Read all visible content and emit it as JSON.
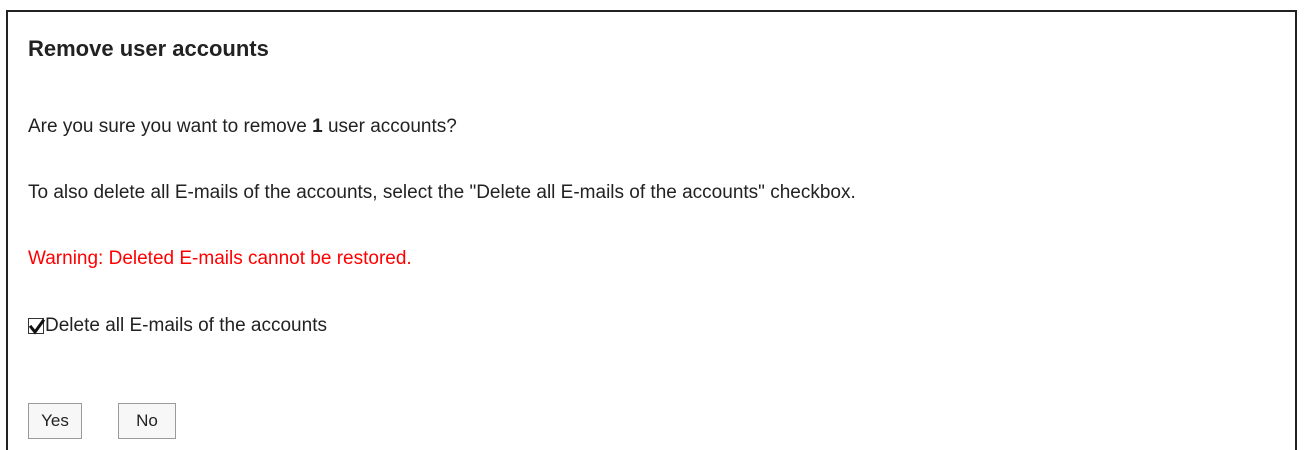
{
  "dialog": {
    "title": "Remove user accounts",
    "confirm_prefix": "Are you sure you want to remove ",
    "count": "1",
    "confirm_suffix": " user accounts?",
    "instruction": "To also delete all E-mails of the accounts, select the \"Delete all E-mails of the accounts\" checkbox.",
    "warning": "Warning: Deleted E-mails cannot be restored.",
    "warning_color": "#ff0000",
    "checkbox": {
      "label": "Delete all E-mails of the accounts",
      "checked": true,
      "icon": "checkmark-icon"
    },
    "buttons": {
      "yes_label": "Yes",
      "no_label": "No"
    }
  }
}
